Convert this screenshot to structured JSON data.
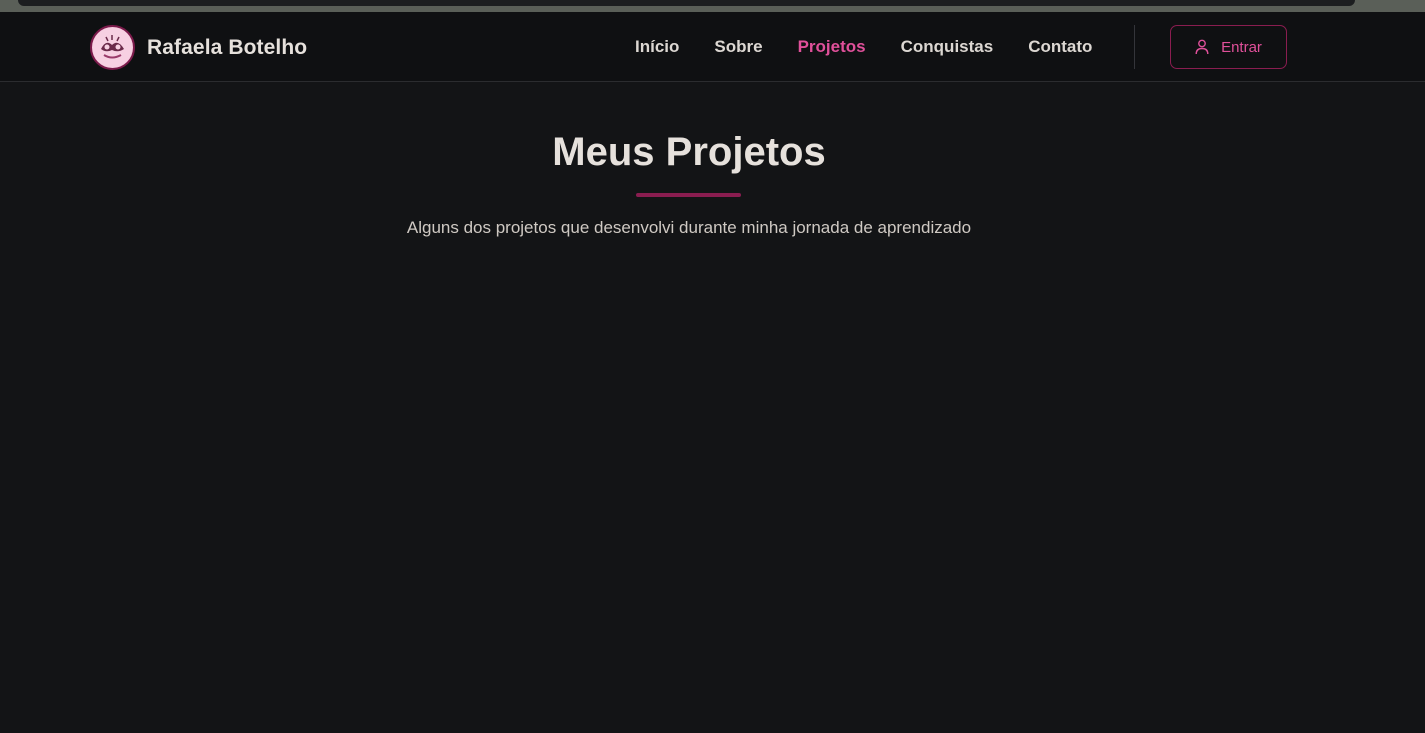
{
  "header": {
    "brand_name": "Rafaela Botelho",
    "nav": [
      {
        "label": "Início",
        "active": false
      },
      {
        "label": "Sobre",
        "active": false
      },
      {
        "label": "Projetos",
        "active": true
      },
      {
        "label": "Conquistas",
        "active": false
      },
      {
        "label": "Contato",
        "active": false
      }
    ],
    "login": {
      "label": "Entrar",
      "icon": "user-icon"
    }
  },
  "main": {
    "title": "Meus Projetos",
    "subtitle": "Alguns dos projetos que desenvolvi durante minha jornada de aprendizado"
  },
  "colors": {
    "background": "#131416",
    "navbar": "#0f1012",
    "accent": "#e0509a",
    "accent_dark": "#8a1d50",
    "text": "#e6e1dc"
  }
}
